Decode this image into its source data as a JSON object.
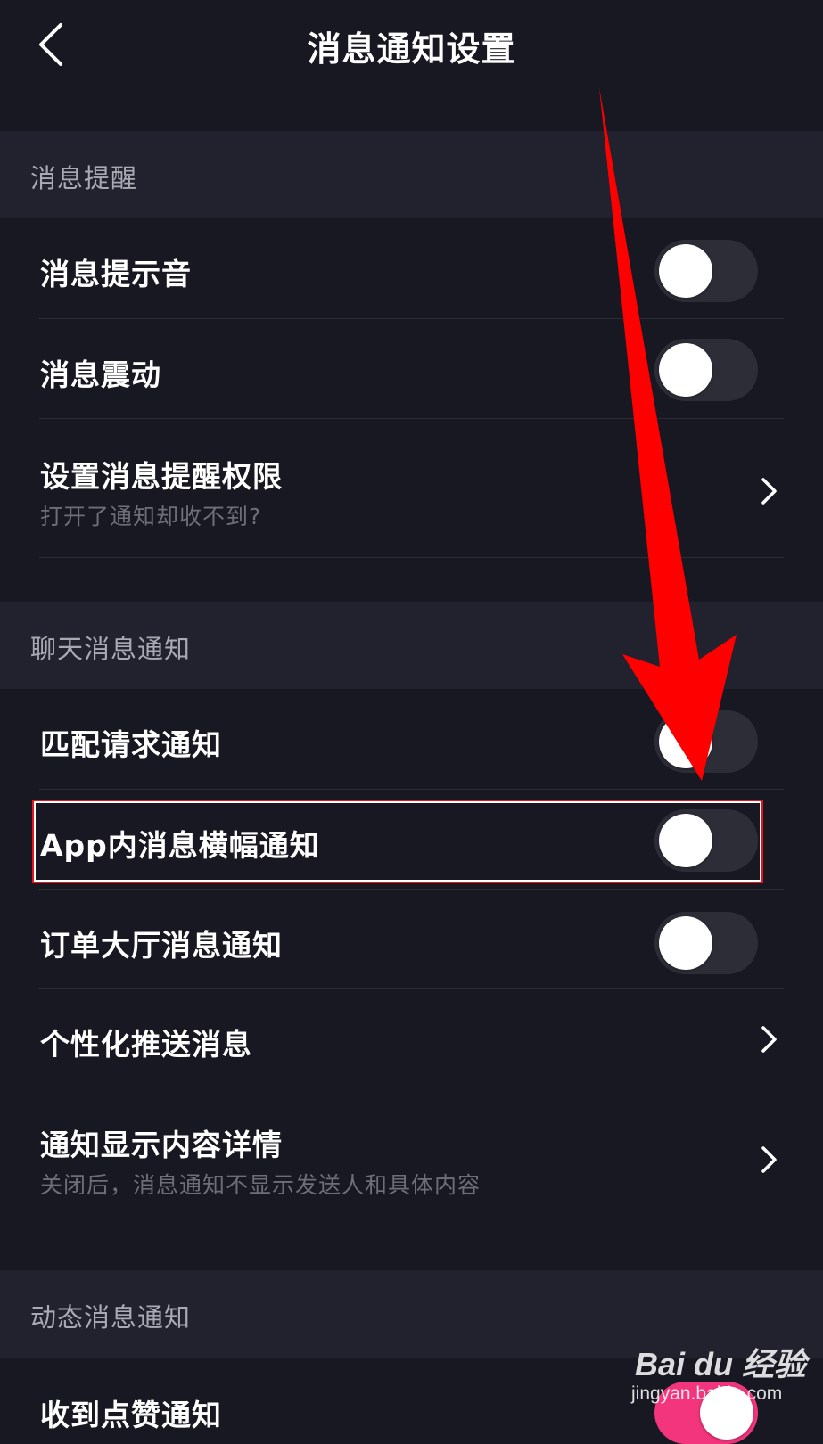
{
  "header": {
    "title": "消息通知设置"
  },
  "sections": [
    {
      "title": "消息提醒",
      "items": [
        {
          "title": "消息提示音",
          "control": "toggle",
          "on": false
        },
        {
          "title": "消息震动",
          "control": "toggle",
          "on": false
        },
        {
          "title": "设置消息提醒权限",
          "subtitle": "打开了通知却收不到?",
          "control": "chevron"
        }
      ]
    },
    {
      "title": "聊天消息通知",
      "items": [
        {
          "title": "匹配请求通知",
          "control": "toggle",
          "on": false
        },
        {
          "title": "App内消息横幅通知",
          "control": "toggle",
          "on": false,
          "highlighted": true
        },
        {
          "title": "订单大厅消息通知",
          "control": "toggle",
          "on": false
        },
        {
          "title": "个性化推送消息",
          "control": "chevron"
        },
        {
          "title": "通知显示内容详情",
          "subtitle": "关闭后，消息通知不显示发送人和具体内容",
          "control": "chevron"
        }
      ]
    },
    {
      "title": "动态消息通知",
      "items": [
        {
          "title": "收到点赞通知",
          "control": "toggle",
          "on": true
        }
      ]
    }
  ],
  "watermark": {
    "brand": "Bai du 经验",
    "url": "jingyan.baidu.com"
  },
  "colors": {
    "background": "#181822",
    "section_header_bg": "#22222e",
    "toggle_off": "#2d2d38",
    "toggle_on": "#f2357c",
    "annotation_red": "#ff0000"
  }
}
